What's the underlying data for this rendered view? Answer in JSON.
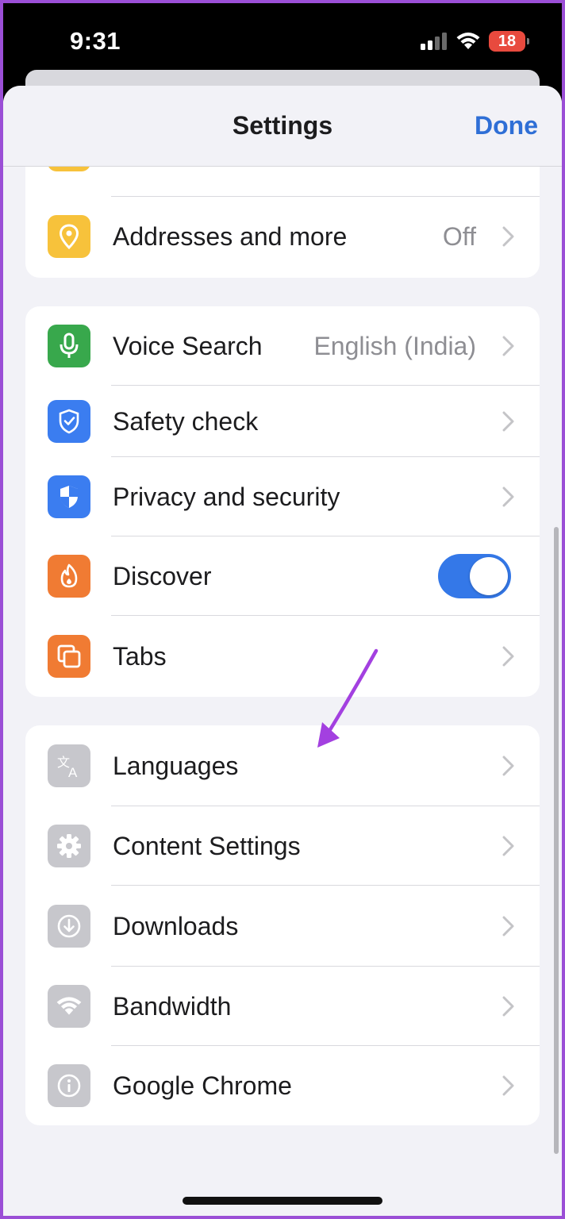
{
  "status": {
    "time": "9:31",
    "battery": "18",
    "icons": [
      "signal-icon",
      "wifi-icon",
      "battery-icon"
    ]
  },
  "nav": {
    "title": "Settings",
    "done_label": "Done"
  },
  "colors": {
    "accent": "#2f6fd6",
    "toggle_on": "#3478e8",
    "frame": "#9b4fd6",
    "arrow": "#a340e0"
  },
  "group1": {
    "items": [
      {
        "label": "Addresses and more",
        "value": "Off",
        "icon": "location-pin-icon",
        "icon_color": "#f7c23b"
      }
    ]
  },
  "group2": {
    "items": [
      {
        "label": "Voice Search",
        "value": "English (India)",
        "icon": "microphone-icon",
        "icon_color": "#38a84c"
      },
      {
        "label": "Safety check",
        "value": "",
        "icon": "shield-check-icon",
        "icon_color": "#3b7df0"
      },
      {
        "label": "Privacy and security",
        "value": "",
        "icon": "shield-icon",
        "icon_color": "#3b7df0"
      },
      {
        "label": "Discover",
        "toggle": true,
        "icon": "flame-icon",
        "icon_color": "#f07b33"
      },
      {
        "label": "Tabs",
        "value": "",
        "icon": "tabs-icon",
        "icon_color": "#f07b33"
      }
    ]
  },
  "group3": {
    "items": [
      {
        "label": "Languages",
        "icon": "translate-icon",
        "icon_color": "#c7c7cc"
      },
      {
        "label": "Content Settings",
        "icon": "gear-icon",
        "icon_color": "#c7c7cc"
      },
      {
        "label": "Downloads",
        "icon": "download-icon",
        "icon_color": "#c7c7cc"
      },
      {
        "label": "Bandwidth",
        "icon": "wifi-icon",
        "icon_color": "#c7c7cc"
      },
      {
        "label": "Google Chrome",
        "icon": "info-icon",
        "icon_color": "#c7c7cc"
      }
    ]
  }
}
